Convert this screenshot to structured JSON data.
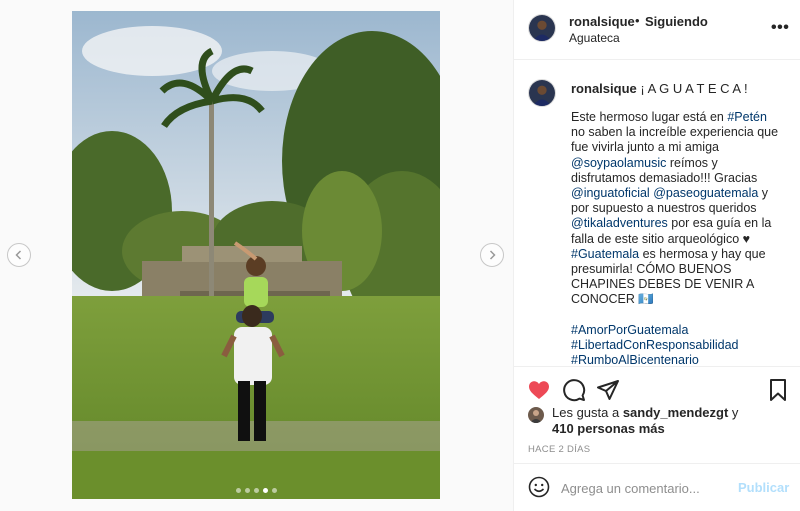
{
  "post": {
    "username": "ronalsique",
    "follow_separator": "•",
    "follow_status": "Siguiendo",
    "location": "Aguateca",
    "more_label": "•••"
  },
  "caption": {
    "title": "¡ A G U A T E C A !",
    "segments": [
      {
        "text": "Este hermoso lugar está en ",
        "tag": false
      },
      {
        "text": "#Petén",
        "tag": true
      },
      {
        "text": " no saben la increíble experiencia que fue vivirla junto a mi amiga ",
        "tag": false
      },
      {
        "text": "@soypaolamusic",
        "tag": true
      },
      {
        "text": " reímos y disfrutamos demasiado!!! Gracias ",
        "tag": false
      },
      {
        "text": "@inguatoficial",
        "tag": true
      },
      {
        "text": " ",
        "tag": false
      },
      {
        "text": "@paseoguatemala",
        "tag": true
      },
      {
        "text": " y por supuesto a nuestros queridos ",
        "tag": false
      },
      {
        "text": "@tikaladventures",
        "tag": true
      },
      {
        "text": " por esa guía en la falla de este sitio arqueológico ♥ ",
        "tag": false
      },
      {
        "text": "#Guatemala",
        "tag": true
      },
      {
        "text": " es hermosa y hay que presumirla! CÓMO BUENOS CHAPINES DEBES DE VENIR A CONOCER 🇬🇹\n\n",
        "tag": false
      },
      {
        "text": "#AmorPorGuatemala",
        "tag": true
      },
      {
        "text": "\n",
        "tag": false
      },
      {
        "text": "#LibertadConResponsabilidad",
        "tag": true
      },
      {
        "text": "\n",
        "tag": false
      },
      {
        "text": "#RumboAlBicentenario",
        "tag": true
      }
    ]
  },
  "likes": {
    "prefix": "Les gusta a ",
    "user": "sandy_mendezgt",
    "suffix": " y",
    "others": "410 personas más"
  },
  "timestamp": "HACE 2 DÍAS",
  "comment": {
    "placeholder": "Agrega un comentario...",
    "publish_label": "Publicar"
  },
  "carousel": {
    "count": 5,
    "active_index": 3
  },
  "colors": {
    "like_red": "#ed4956",
    "tag_blue": "#00376b",
    "publish_disabled": "#b2dffc",
    "muted": "#8e8e8e"
  }
}
